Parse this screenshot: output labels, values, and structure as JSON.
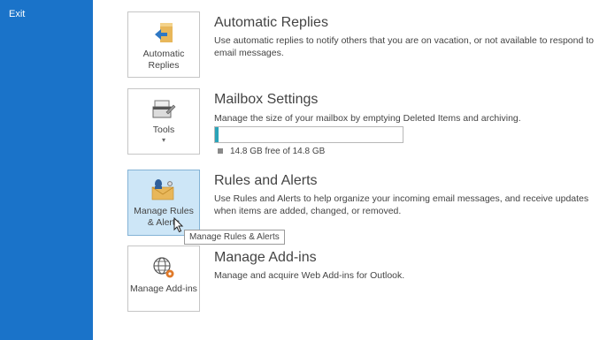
{
  "sidebar": {
    "exit_label": "Exit"
  },
  "sections": {
    "automatic_replies": {
      "tile_label": "Automatic Replies",
      "title": "Automatic Replies",
      "description": "Use automatic replies to notify others that you are on vacation, or not available to respond to email messages."
    },
    "mailbox_settings": {
      "tile_label": "Tools",
      "title": "Mailbox Settings",
      "description": "Manage the size of your mailbox by emptying Deleted Items and archiving.",
      "storage_text": "14.8 GB free of 14.8 GB",
      "usage_fraction": 0.01
    },
    "rules_alerts": {
      "tile_label": "Manage Rules & Alerts",
      "title": "Rules and Alerts",
      "description": "Use Rules and Alerts to help organize your incoming email messages, and receive updates when items are added, changed, or removed.",
      "tooltip": "Manage Rules & Alerts"
    },
    "addins": {
      "tile_label": "Manage Add-ins",
      "title": "Manage Add-ins",
      "description": "Manage and acquire Web Add-ins for Outlook."
    }
  },
  "colors": {
    "sidebar": "#1a73c9",
    "progress_fill": "#2aa3b8",
    "hover_tile": "#cde6f7"
  }
}
